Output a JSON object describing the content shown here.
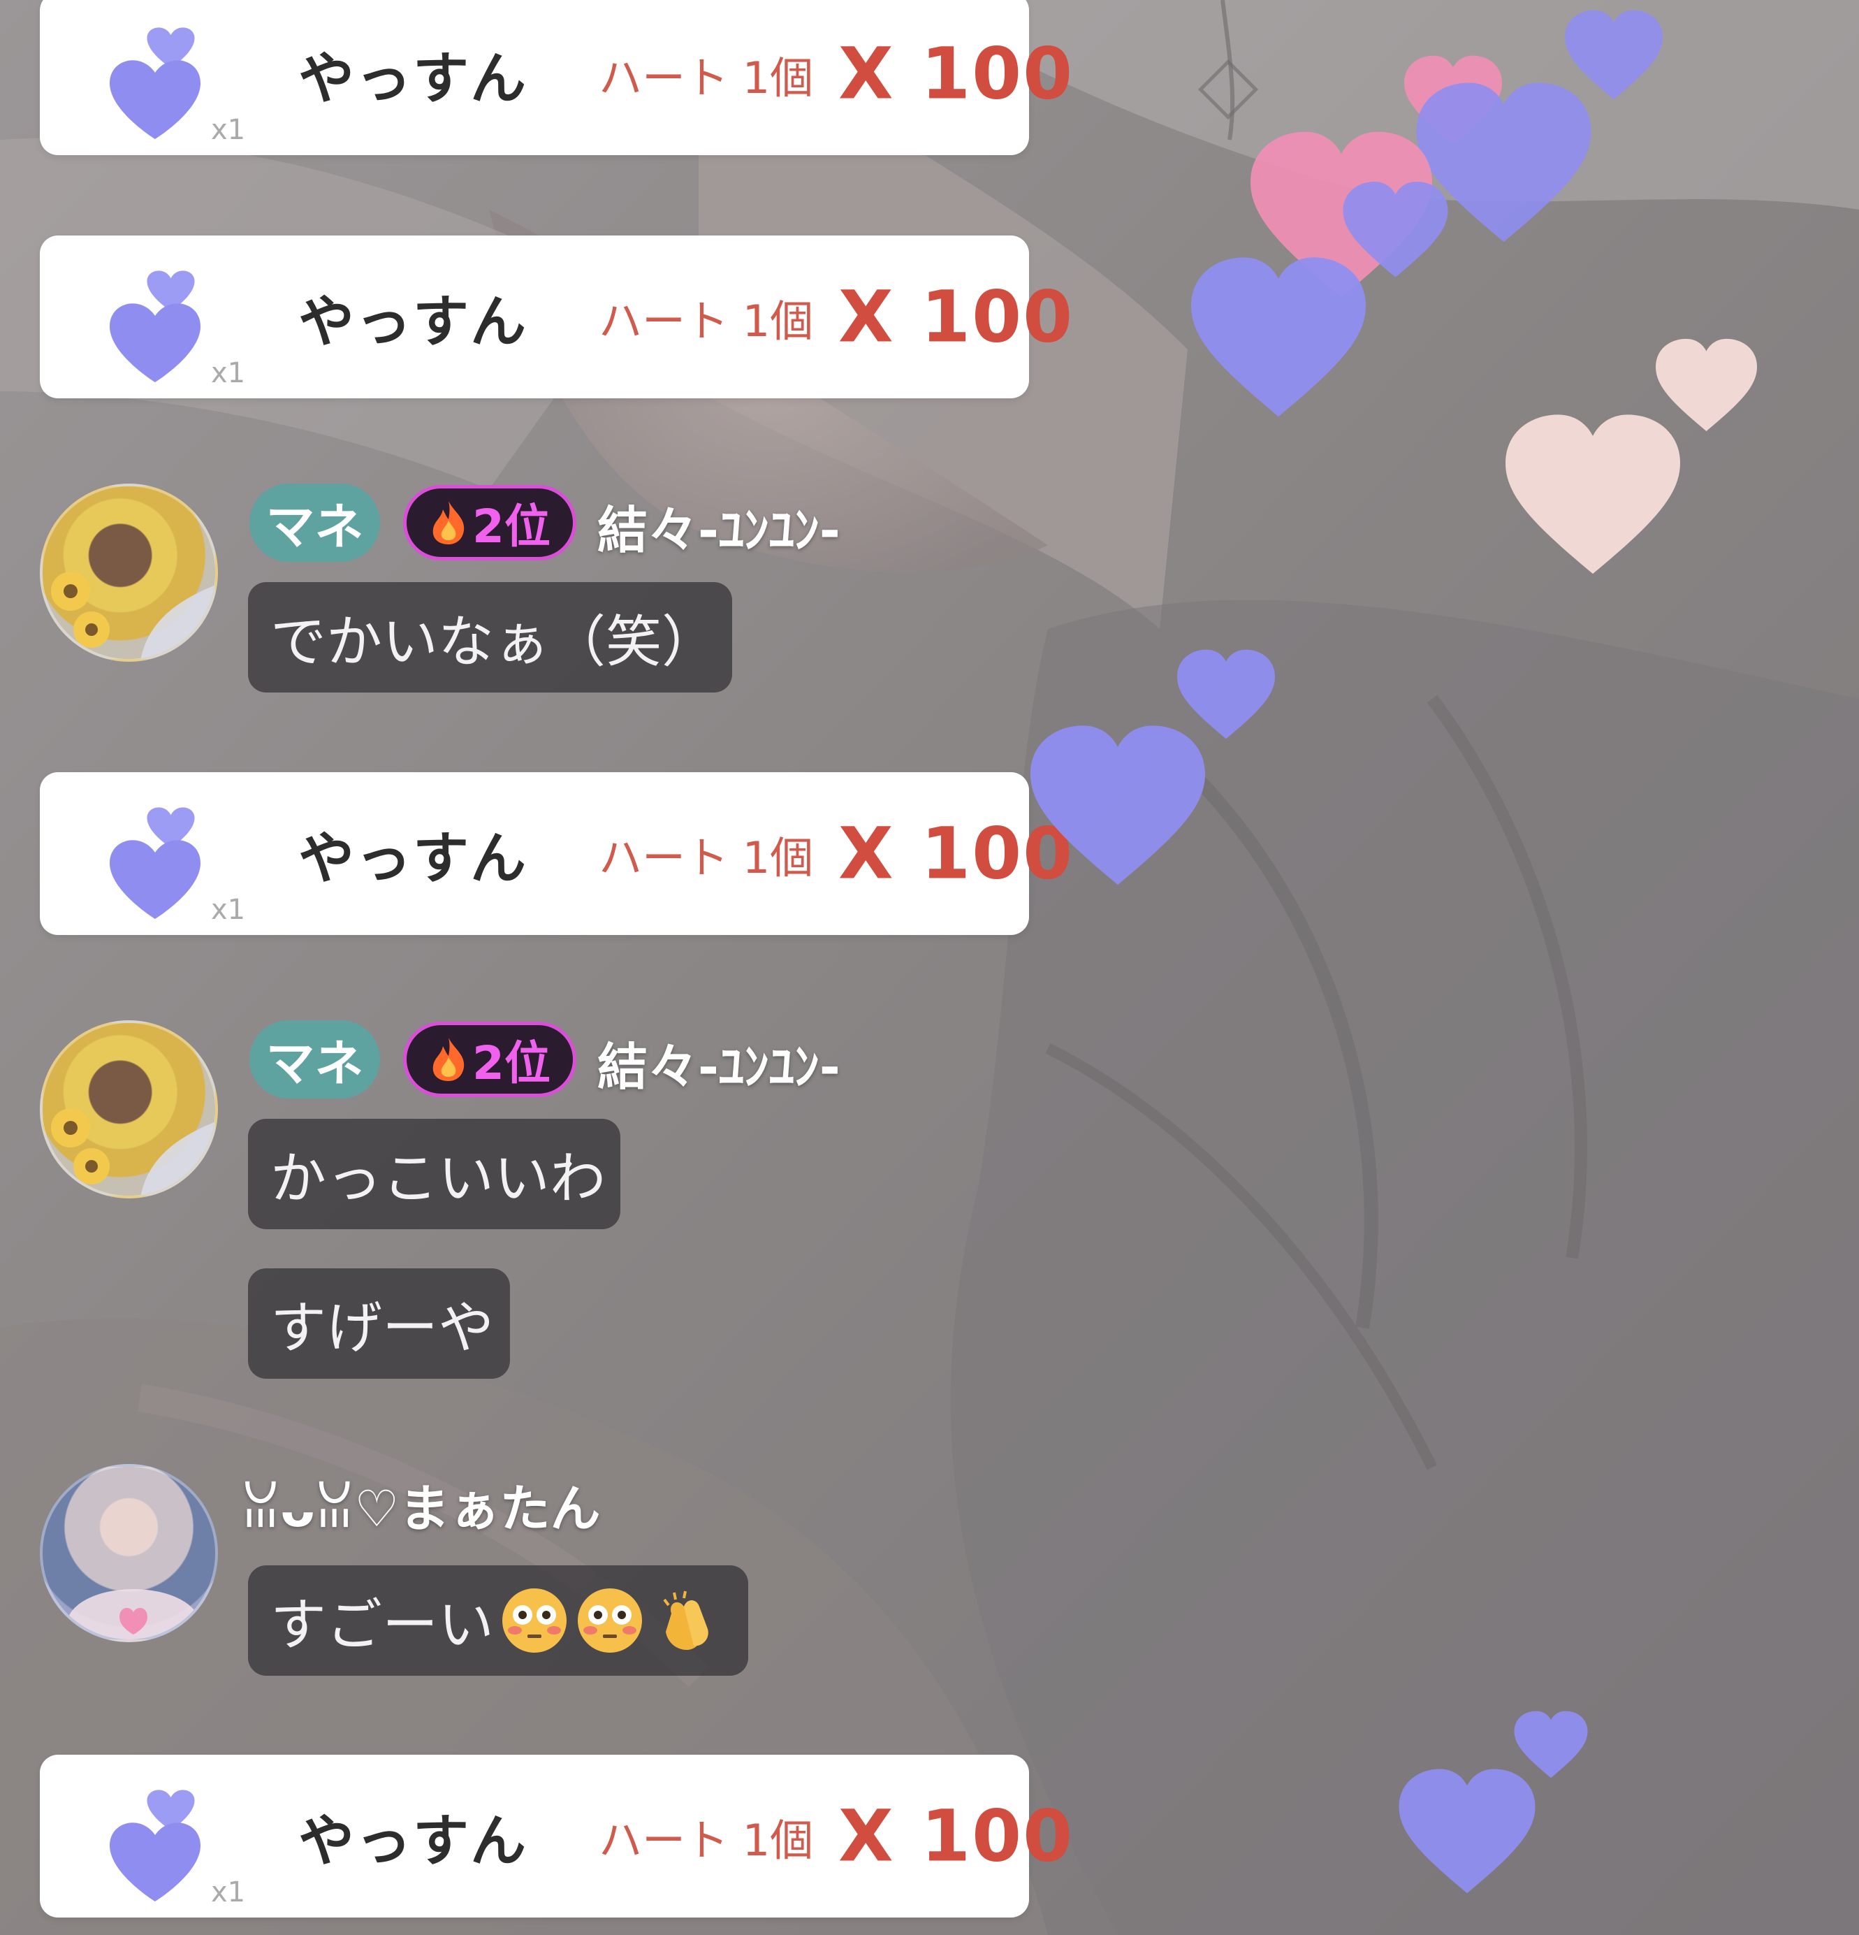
{
  "gift_events": [
    {
      "user": "やっすん",
      "item": "ハート 1個",
      "quantity": "X 100",
      "icon": "purple-heart-gift-icon",
      "icon_count": "x1"
    },
    {
      "user": "やっすん",
      "item": "ハート 1個",
      "quantity": "X 100",
      "icon": "purple-heart-gift-icon",
      "icon_count": "x1"
    },
    {
      "user": "やっすん",
      "item": "ハート 1個",
      "quantity": "X 100",
      "icon": "purple-heart-gift-icon",
      "icon_count": "x1"
    },
    {
      "user": "やっすん",
      "item": "ハート 1個",
      "quantity": "X 100",
      "icon": "purple-heart-gift-icon",
      "icon_count": "x1"
    }
  ],
  "comment_groups": [
    {
      "badge_label": "マネ",
      "rank_label": "2位",
      "rank_icon": "fire-icon",
      "user": "結々-ﾕﾝﾕﾝ-",
      "messages": [
        "でかいなぁ（笑）"
      ]
    },
    {
      "badge_label": "マネ",
      "rank_label": "2位",
      "rank_icon": "fire-icon",
      "user": "結々-ﾕﾝﾕﾝ-",
      "messages": [
        "かっこいいわ",
        "すげーや"
      ]
    },
    {
      "user": "ꈍᴗꈍ♡まぁたん",
      "messages": [
        {
          "text": "すごーい",
          "emojis": [
            "flushed-face-emoji",
            "flushed-face-emoji",
            "clapping-hands-emoji"
          ]
        }
      ]
    }
  ],
  "colors": {
    "gift_card_bg": "#ffffff",
    "gift_user": "#2d2d2d",
    "gift_item": "#d05a4c",
    "gift_quantity": "#d04d3f",
    "badge_mane": "#5fa3a0",
    "badge_rank_border": "#d94fd8",
    "badge_rank_text": "#f062ee",
    "bubble_bg": "#323034",
    "heart_purple": "#8f8ef0",
    "heart_pink": "#f28fb6",
    "heart_peach": "#f6dcd8"
  }
}
